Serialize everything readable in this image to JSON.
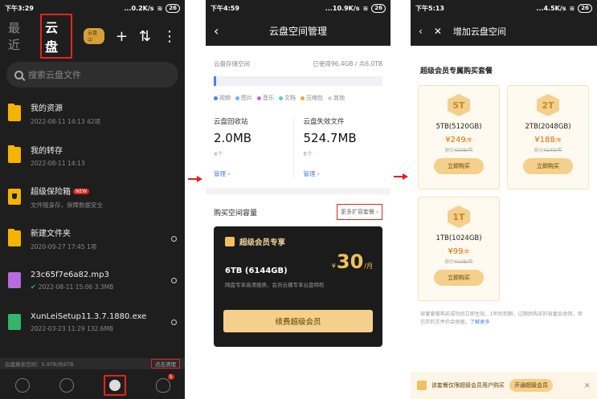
{
  "arrows": [
    "arrow-right",
    "arrow-right"
  ],
  "panel1": {
    "status": {
      "time": "下午3:29",
      "net": "...0.2K/s",
      "battery": "26"
    },
    "tabs": {
      "recent": "最近",
      "cloud": "云盘"
    },
    "vip_badge": "云盘中",
    "header_icons": [
      "plus-icon",
      "sort-icon",
      "more-icon"
    ],
    "search_placeholder": "搜索云盘文件",
    "files": [
      {
        "name": "我的资源",
        "meta": "2022-08-11 14:13 42项",
        "icon": "folder-icon"
      },
      {
        "name": "我的转存",
        "meta": "2022-08-11 14:13",
        "icon": "folder-icon"
      },
      {
        "name": "超级保险箱",
        "badge": "NEW",
        "meta": "文件随身存，保障数据安全",
        "icon": "safe-icon"
      },
      {
        "name": "新建文件夹",
        "meta": "2020-09-27 17:45 1项",
        "icon": "folder-icon"
      },
      {
        "name": "23c65f7e6a82.mp3",
        "meta": "2022-08-11 15:06 3.3MB",
        "icon": "music-icon",
        "synced": true
      },
      {
        "name": "XunLeiSetup11.3.7.1880.exe",
        "meta": "2022-03-23 11:29 132.6MB",
        "icon": "exe-icon"
      }
    ],
    "space_text": "云盘剩余空间：5.9TB/共6TB",
    "clean_button": "点击清理",
    "nav_badge": "5"
  },
  "panel2": {
    "status": {
      "time": "下午4:59",
      "net": "...10.9K/s",
      "battery": "26"
    },
    "title": "云盘空间管理",
    "storage_label": "云盘存储空间",
    "storage_used": "已使用96.4GB / 共6.0TB",
    "usage_fraction": 0.016,
    "legend": [
      {
        "name": "视频",
        "color": "#4a7de8"
      },
      {
        "name": "图片",
        "color": "#4fc3f7"
      },
      {
        "name": "音乐",
        "color": "#b86ae0"
      },
      {
        "name": "文档",
        "color": "#4dd0c8"
      },
      {
        "name": "压缩包",
        "color": "#f4a23a"
      },
      {
        "name": "其他",
        "color": "#cfcfcf"
      }
    ],
    "recycle": {
      "title": "云盘回收站",
      "value": "2.0MB",
      "count": "4个",
      "manage": "管理 ›"
    },
    "invalid": {
      "title": "云盘失效文件",
      "value": "524.7MB",
      "count": "6个",
      "manage": "管理 ›"
    },
    "buy_title": "购买空间容量",
    "more_plans": "更多扩容套餐 ›",
    "vip": {
      "title": "超级会员专享",
      "size": "6TB (6144GB)",
      "desc": "网盘专享高清画质，会员云播专享云盘特权",
      "currency": "¥",
      "price": "30",
      "unit": "/月",
      "button": "续费超级会员"
    }
  },
  "panel3": {
    "status": {
      "time": "下午5:13",
      "net": "...4.5K/s",
      "battery": "26"
    },
    "title": "增加云盘空间",
    "section": "超级会员专属购买套餐",
    "plans": [
      {
        "icon": "5T",
        "name": "5TB(5120GB)",
        "price": "¥249",
        "unit": "/年",
        "orig_label": "原价",
        "orig": "¥298/年",
        "button": "立即购买"
      },
      {
        "icon": "2T",
        "name": "2TB(2048GB)",
        "price": "¥188",
        "unit": "/年",
        "orig_label": "原价",
        "orig": "¥249/年",
        "button": "立即购买"
      },
      {
        "icon": "1T",
        "name": "1TB(1024GB)",
        "price": "¥99",
        "unit": "/年",
        "orig_label": "原价",
        "orig": "¥198/年",
        "button": "立即购买"
      }
    ],
    "note": "容量套餐购买成功后立即生效，1年后到期，过期后购买的容量会收回，但已存的文件仍会保留。",
    "note_link": "了解更多",
    "banner_text": "该套餐仅限超级会员用户购买",
    "banner_button": "开通超级会员",
    "banner_close": "×"
  }
}
